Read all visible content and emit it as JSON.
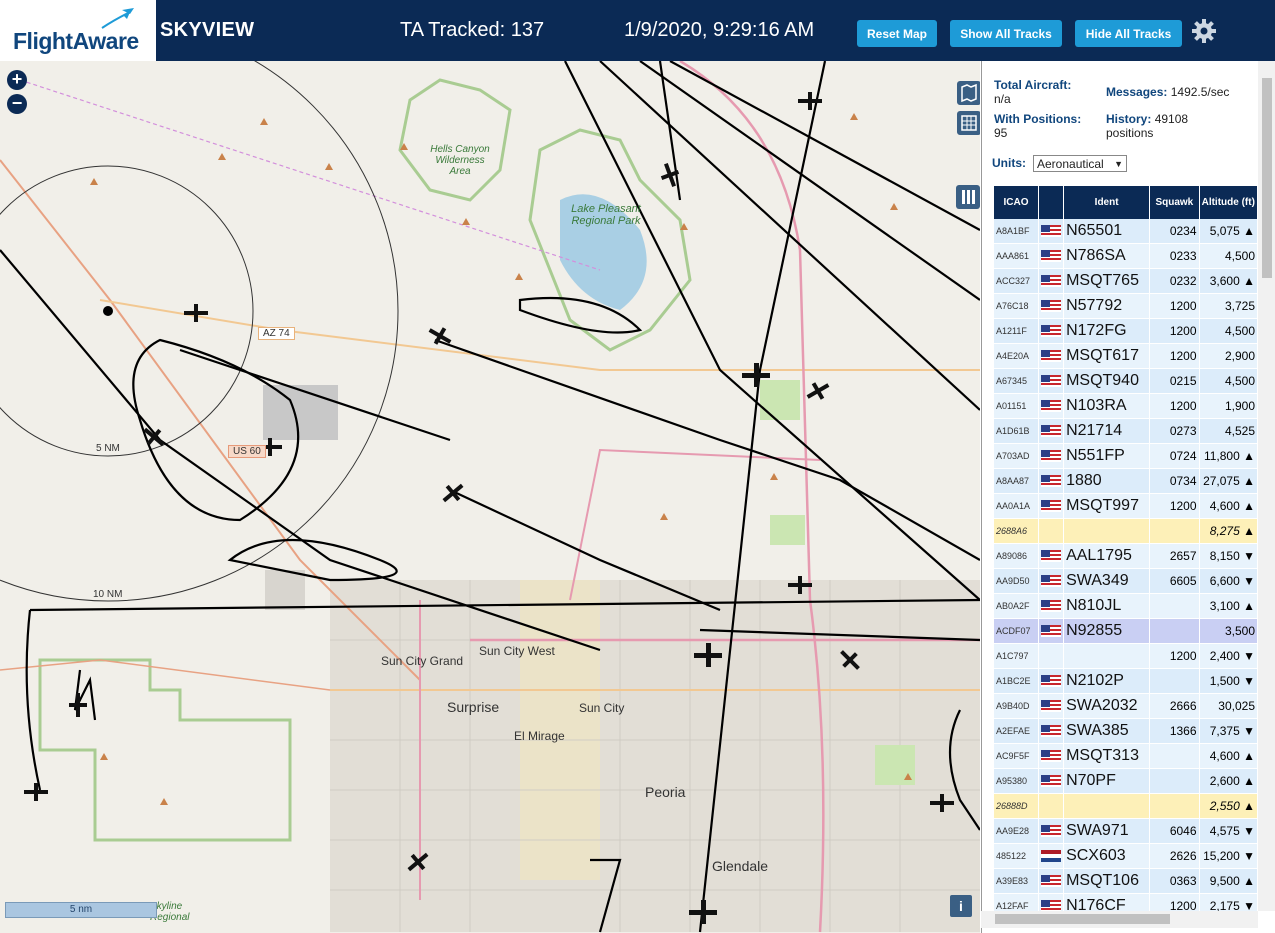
{
  "header": {
    "logo_text": "FlightAware",
    "app_title": "SKYVIEW",
    "tracked": "TA Tracked: 137",
    "datetime": "1/9/2020, 9:29:16 AM",
    "reset_label": "Reset Map",
    "show_label": "Show All Tracks",
    "hide_label": "Hide All Tracks",
    "settings_icon": "gear-icon"
  },
  "map": {
    "zoom_in": "+",
    "zoom_out": "−",
    "scale_label": "5 nm",
    "info_label": "i",
    "labels": {
      "hells_canyon": "Hells Canyon Wilderness Area",
      "lake_pleasant": "Lake Pleasant Regional Park",
      "az74": "AZ 74",
      "us60": "US 60",
      "ring5": "5 NM",
      "ring10": "10 NM",
      "sun_city_grand": "Sun City Grand",
      "sun_city_west": "Sun City West",
      "surprise": "Surprise",
      "sun_city": "Sun City",
      "el_mirage": "El Mirage",
      "peoria": "Peoria",
      "glendale": "Glendale",
      "skyline": "Skyline Regional"
    }
  },
  "stats": {
    "total_label": "Total Aircraft:",
    "total_value": "n/a",
    "positions_label": "With Positions:",
    "positions_value": "95",
    "messages_label": "Messages:",
    "messages_value": "1492.5/sec",
    "history_label": "History:",
    "history_value": "49108 positions",
    "units_label": "Units:",
    "units_value": "Aeronautical"
  },
  "table": {
    "headers": {
      "icao": "ICAO",
      "ident": "Ident",
      "squawk": "Squawk",
      "altitude": "Altitude (ft)"
    },
    "rows": [
      {
        "icao": "A8A1BF",
        "flag": "us",
        "ident": "N65501",
        "squawk": "0234",
        "alt": "5,075 ▲",
        "style": ""
      },
      {
        "icao": "AAA861",
        "flag": "us",
        "ident": "N786SA",
        "squawk": "0233",
        "alt": "4,500",
        "style": "even"
      },
      {
        "icao": "ACC327",
        "flag": "us",
        "ident": "MSQT765",
        "squawk": "0232",
        "alt": "3,600 ▲",
        "style": ""
      },
      {
        "icao": "A76C18",
        "flag": "us",
        "ident": "N57792",
        "squawk": "1200",
        "alt": "3,725",
        "style": "even"
      },
      {
        "icao": "A1211F",
        "flag": "us",
        "ident": "N172FG",
        "squawk": "1200",
        "alt": "4,500",
        "style": ""
      },
      {
        "icao": "A4E20A",
        "flag": "us",
        "ident": "MSQT617",
        "squawk": "1200",
        "alt": "2,900",
        "style": "even"
      },
      {
        "icao": "A67345",
        "flag": "us",
        "ident": "MSQT940",
        "squawk": "0215",
        "alt": "4,500",
        "style": ""
      },
      {
        "icao": "A01151",
        "flag": "us",
        "ident": "N103RA",
        "squawk": "1200",
        "alt": "1,900",
        "style": "even"
      },
      {
        "icao": "A1D61B",
        "flag": "us",
        "ident": "N21714",
        "squawk": "0273",
        "alt": "4,525",
        "style": ""
      },
      {
        "icao": "A703AD",
        "flag": "us",
        "ident": "N551FP",
        "squawk": "0724",
        "alt": "11,800 ▲",
        "style": "even"
      },
      {
        "icao": "A8AA87",
        "flag": "us",
        "ident": "1880",
        "squawk": "0734",
        "alt": "27,075 ▲",
        "style": ""
      },
      {
        "icao": "AA0A1A",
        "flag": "us",
        "ident": "MSQT997",
        "squawk": "1200",
        "alt": "4,600 ▲",
        "style": "even"
      },
      {
        "icao": "2688A6",
        "flag": "",
        "ident": "",
        "squawk": "",
        "alt": "8,275 ▲",
        "style": "yellow"
      },
      {
        "icao": "A89086",
        "flag": "us",
        "ident": "AAL1795",
        "squawk": "2657",
        "alt": "8,150 ▼",
        "style": "even"
      },
      {
        "icao": "AA9D50",
        "flag": "us",
        "ident": "SWA349",
        "squawk": "6605",
        "alt": "6,600 ▼",
        "style": ""
      },
      {
        "icao": "AB0A2F",
        "flag": "us",
        "ident": "N810JL",
        "squawk": "",
        "alt": "3,100 ▲",
        "style": "even"
      },
      {
        "icao": "ACDF07",
        "flag": "us",
        "ident": "N92855",
        "squawk": "",
        "alt": "3,500",
        "style": "sel"
      },
      {
        "icao": "A1C797",
        "flag": "",
        "ident": "",
        "squawk": "1200",
        "alt": "2,400 ▼",
        "style": "even"
      },
      {
        "icao": "A1BC2E",
        "flag": "us",
        "ident": "N2102P",
        "squawk": "",
        "alt": "1,500 ▼",
        "style": ""
      },
      {
        "icao": "A9B40D",
        "flag": "us",
        "ident": "SWA2032",
        "squawk": "2666",
        "alt": "30,025",
        "style": "even"
      },
      {
        "icao": "A2EFAE",
        "flag": "us",
        "ident": "SWA385",
        "squawk": "1366",
        "alt": "7,375 ▼",
        "style": ""
      },
      {
        "icao": "AC9F5F",
        "flag": "us",
        "ident": "MSQT313",
        "squawk": "",
        "alt": "4,600 ▲",
        "style": "even"
      },
      {
        "icao": "A95380",
        "flag": "us",
        "ident": "N70PF",
        "squawk": "",
        "alt": "2,600 ▲",
        "style": ""
      },
      {
        "icao": "26888D",
        "flag": "",
        "ident": "",
        "squawk": "",
        "alt": "2,550 ▲",
        "style": "yellow"
      },
      {
        "icao": "AA9E28",
        "flag": "us",
        "ident": "SWA971",
        "squawk": "6046",
        "alt": "4,575 ▼",
        "style": ""
      },
      {
        "icao": "485122",
        "flag": "nl",
        "ident": "SCX603",
        "squawk": "2626",
        "alt": "15,200 ▼",
        "style": "even"
      },
      {
        "icao": "A39E83",
        "flag": "us",
        "ident": "MSQT106",
        "squawk": "0363",
        "alt": "9,500 ▲",
        "style": ""
      },
      {
        "icao": "A12FAF",
        "flag": "us",
        "ident": "N176CF",
        "squawk": "1200",
        "alt": "2,175 ▼",
        "style": "even"
      }
    ]
  }
}
